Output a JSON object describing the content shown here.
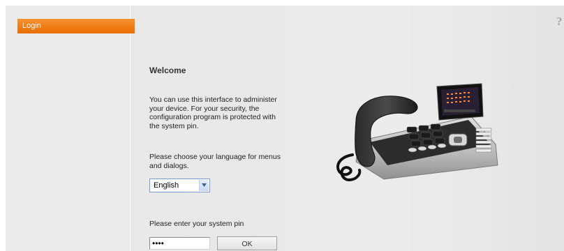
{
  "sidebar": {
    "items": [
      {
        "label": "Login"
      }
    ]
  },
  "header": {
    "help_label": "?"
  },
  "main": {
    "title": "Welcome",
    "intro_lines": [
      "You can use this interface to administer",
      "your device. For your security, the",
      "configuration program is protected with",
      "the system pin."
    ],
    "language_lines": [
      "Please choose your language for menus",
      "and dialogs."
    ],
    "language_select": {
      "value": "English"
    },
    "pin_prompt": "Please enter your system pin",
    "pin_input": {
      "value": "••••"
    },
    "ok_label": "OK"
  },
  "device_icon": "desk-phone-image",
  "colors": {
    "accent": "#f07d14",
    "background": "#ebebeb"
  }
}
